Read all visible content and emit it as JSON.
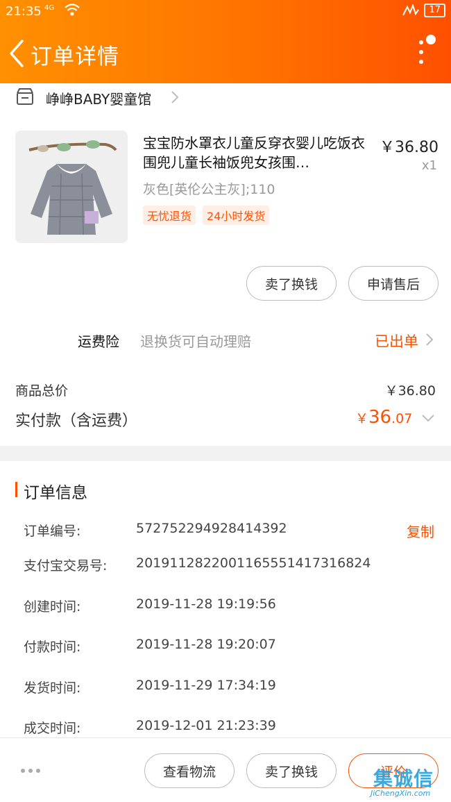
{
  "status_bar": {
    "time": "21:35",
    "network": "4G",
    "battery": "17"
  },
  "header": {
    "title": "订单详情"
  },
  "shop": {
    "name": "峥峥BABY婴童馆"
  },
  "product": {
    "title": "宝宝防水罩衣儿童反穿衣婴儿吃饭衣围兜儿童长袖饭兜女孩围…",
    "price": "￥36.80",
    "quantity": "x1",
    "sku": "灰色[英伦公主灰];110",
    "tags": [
      "无忧退货",
      "24小时发货"
    ],
    "buttons": {
      "sell": "卖了换钱",
      "after_sale": "申请售后"
    }
  },
  "insurance": {
    "label": "运费险",
    "desc": "退换货可自动理赔",
    "status": "已出单"
  },
  "totals": {
    "goods_label": "商品总价",
    "goods_value": "￥36.80",
    "paid_label": "实付款（含运费）",
    "paid_currency": "￥",
    "paid_int": "36",
    "paid_dec": ".07"
  },
  "order_info": {
    "title": "订单信息",
    "copy_label": "复制",
    "rows": [
      {
        "label": "订单编号:",
        "value": "572752294928414392"
      },
      {
        "label": "支付宝交易号:",
        "value": "2019112822001165551417316824"
      },
      {
        "label": "创建时间:",
        "value": "2019-11-28 19:19:56"
      },
      {
        "label": "付款时间:",
        "value": "2019-11-28 19:20:07"
      },
      {
        "label": "发货时间:",
        "value": "2019-11-29 17:34:19"
      },
      {
        "label": "成交时间:",
        "value": "2019-12-01 21:23:39"
      }
    ]
  },
  "bottom_bar": {
    "logistics": "查看物流",
    "sell": "卖了换钱",
    "review": "评价"
  },
  "watermark": {
    "logo": "集诚信",
    "url": "JiChengXin.com"
  },
  "colors": {
    "accent": "#ff5000",
    "header_start": "#ff9000",
    "header_end": "#ff5000"
  },
  "icons": [
    "back-arrow-icon",
    "more-icon",
    "shop-icon",
    "chevron-right-icon",
    "chevron-down-icon",
    "wifi-icon",
    "signal-icon"
  ]
}
